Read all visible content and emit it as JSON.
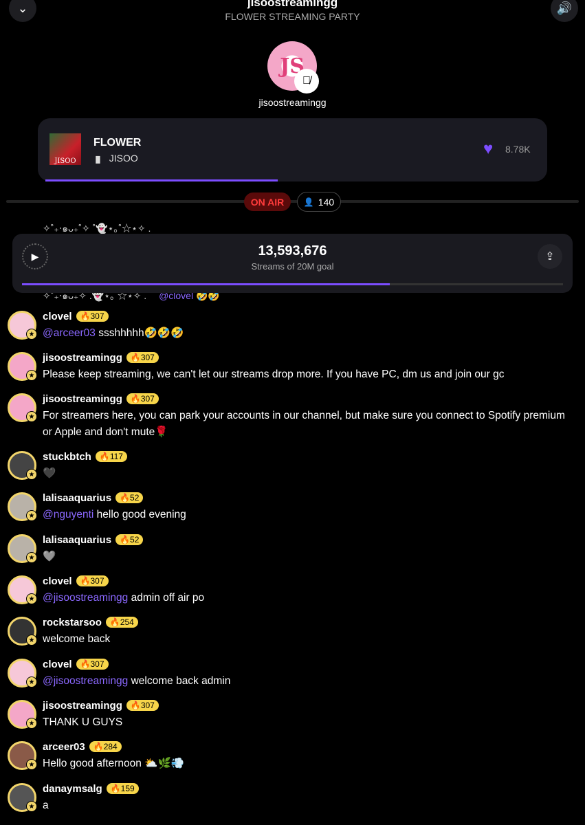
{
  "header": {
    "title": "jisoostreamingg",
    "subtitle": "FLOWER STREAMING PARTY",
    "collapse_icon": "chevron-down-icon",
    "volume_icon": "speaker-icon"
  },
  "host": {
    "name": "jisoostreamingg",
    "mic": "muted"
  },
  "now_playing": {
    "title": "FLOWER",
    "artist": "JISOO",
    "eq": "▐▌",
    "cover_text": "JISOO",
    "likes": "8.78K",
    "progress": 0.47
  },
  "status": {
    "on_air": "ON AIR",
    "listeners": "140"
  },
  "streams": {
    "count": "13,593,676",
    "goal_label": "Streams of 20M goal",
    "progress": 0.68
  },
  "peek": {
    "top": "✧˚₊‧๑ᴗ₊˚✧ ˚👻⋆｡˚☆⋆✧ .",
    "bottom": "✧˚₊‧๑ᴗ₊✧ .👻⋆｡ ☆⋆✧ .",
    "bottom_mention": "@clovel",
    "bottom_emoji": "🤣🤣"
  },
  "colors": {
    "accent": "#7c4dff",
    "badge": "#f7d54a",
    "on_air": "#ff3b3b"
  },
  "messages": [
    {
      "user": "clovel",
      "level": "307",
      "mention": "@arceer03",
      "text": " ssshhhhh🤣🤣🤣",
      "avatar": "#f6c8d8"
    },
    {
      "user": "jisoostreamingg",
      "level": "307",
      "mention": "",
      "text": "Please keep streaming, we can't let our streams drop more. If you have PC, dm us and join our gc",
      "avatar": "#f4a7c8"
    },
    {
      "user": "jisoostreamingg",
      "level": "307",
      "mention": "",
      "text": "For streamers here, you can park your accounts in our channel, but make sure you connect to Spotify premium or Apple and don't mute🌹",
      "avatar": "#f4a7c8"
    },
    {
      "user": "stuckbtch",
      "level": "117",
      "mention": "",
      "text": "🖤",
      "avatar": "#444"
    },
    {
      "user": "lalisaaquarius",
      "level": "52",
      "mention": "@nguyenti",
      "text": " hello good evening",
      "avatar": "#b9b2a8"
    },
    {
      "user": "lalisaaquarius",
      "level": "52",
      "mention": "",
      "text": "🩶",
      "avatar": "#b9b2a8"
    },
    {
      "user": "clovel",
      "level": "307",
      "mention": "@jisoostreamingg",
      "text": " admin off air po",
      "avatar": "#f6c8d8"
    },
    {
      "user": "rockstarsoo",
      "level": "254",
      "mention": "",
      "text": "welcome back",
      "avatar": "#333"
    },
    {
      "user": "clovel",
      "level": "307",
      "mention": "@jisoostreamingg",
      "text": "  welcome back admin",
      "avatar": "#f6c8d8"
    },
    {
      "user": "jisoostreamingg",
      "level": "307",
      "mention": "",
      "text": "THANK U GUYS",
      "avatar": "#f4a7c8"
    },
    {
      "user": "arceer03",
      "level": "284",
      "mention": "",
      "text": "Hello good afternoon ⛅🌿💨",
      "avatar": "#8a5a48"
    },
    {
      "user": "danaymsalg",
      "level": "159",
      "mention": "",
      "text": "a",
      "avatar": "#555"
    }
  ]
}
